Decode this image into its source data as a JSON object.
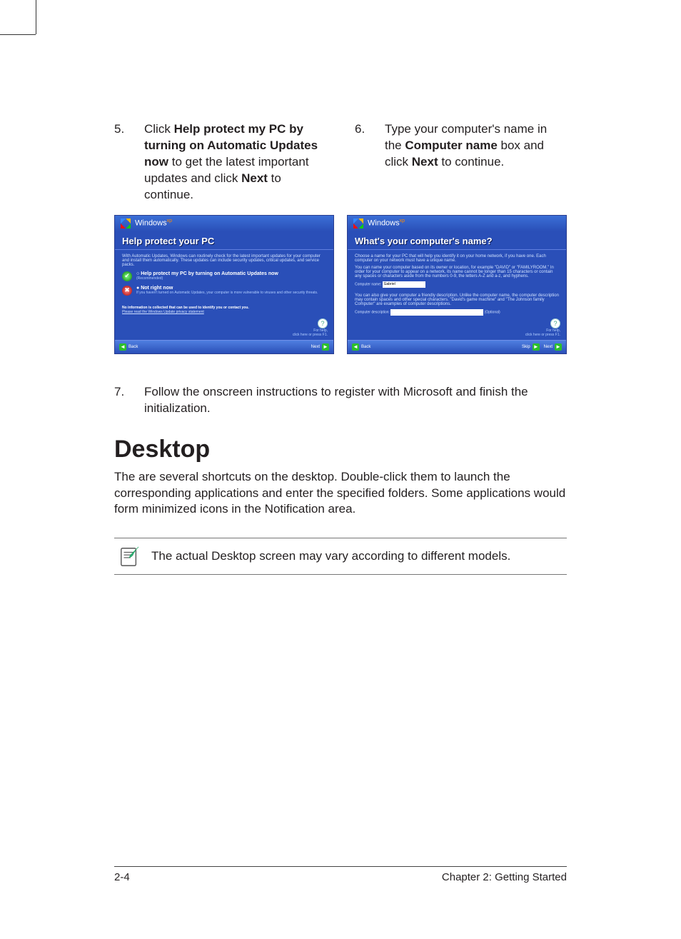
{
  "steps": {
    "s5": {
      "num": "5.",
      "text_a": "Click ",
      "bold_a": "Help protect my PC by turning on Automatic Updates now",
      "text_b": " to get the latest important updates and click ",
      "bold_b": "Next",
      "text_c": " to continue."
    },
    "s6": {
      "num": "6.",
      "text_a": "Type your computer's name in the ",
      "bold_a": "Computer name",
      "text_b": " box and click ",
      "bold_b": "Next",
      "text_c": " to continue."
    },
    "s7": {
      "num": "7.",
      "text": "Follow the onscreen instructions to register with Microsoft and finish the initialization."
    }
  },
  "shot1": {
    "brand": "Windows",
    "brand_sup": "xp",
    "heading": "Help protect your PC",
    "para": "With Automatic Updates, Windows can routinely check for the latest important updates for your computer and install them automatically. These updates can include security updates, critical updates, and service packs.",
    "opt1_title": "Help protect my PC by turning on Automatic Updates now",
    "opt1_sub": "(Recommended)",
    "opt2_title": "Not right now",
    "opt2_sub": "If you haven't turned on Automatic Updates, your computer is more vulnerable to viruses and other security threats.",
    "privacy": "No information is collected that can be used to identify you or contact you.",
    "privacy_link": "Please read the Windows Update privacy statement",
    "help": "For help,",
    "help2": "click here or press F1.",
    "back": "Back",
    "next": "Next"
  },
  "shot2": {
    "brand": "Windows",
    "brand_sup": "xp",
    "heading": "What's your computer's name?",
    "para1": "Choose a name for your PC that will help you identify it on your home network, if you have one. Each computer on your network must have a unique name.",
    "para2": "You can name your computer based on its owner or location, for example \"DAVID\" or \"FAMILYROOM.\" In order for your computer to appear on a network, its name cannot be longer than 15 characters or contain any spaces or characters aside from the numbers 0-9, the letters A-Z and a-z, and hyphens.",
    "name_label": "Computer name:",
    "name_value": "Gabriel",
    "para3": "You can also give your computer a friendly description. Unlike the computer name, the computer description may contain spaces and other special characters. \"David's game machine\" and \"The Johnson family Computer\" are examples of computer descriptions.",
    "desc_label": "Computer description:",
    "optional": "(Optional)",
    "help": "For help,",
    "help2": "click here or press F1.",
    "back": "Back",
    "skip": "Skip",
    "next": "Next"
  },
  "desktop": {
    "title": "Desktop",
    "body": "The are several shortcuts on the desktop. Double-click them to launch the corresponding applications and enter the specified folders. Some applications would form minimized icons in the Notification area.",
    "note": "The actual Desktop screen may vary according to different models."
  },
  "footer": {
    "left": "2-4",
    "right": "Chapter 2: Getting Started"
  }
}
